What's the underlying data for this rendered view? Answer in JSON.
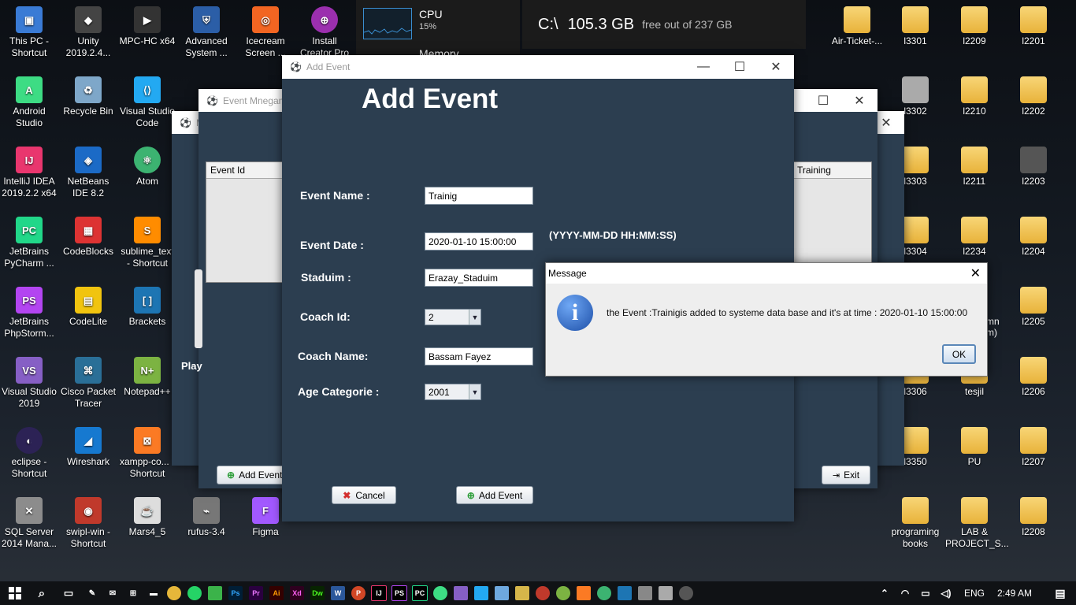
{
  "desktop": {
    "col1": [
      {
        "label": "This PC - Shortcut",
        "color": "#3a7bd5"
      },
      {
        "label": "Android Studio",
        "color": "#3ddc84"
      },
      {
        "label": "IntelliJ IDEA 2019.2.2 x64",
        "color": "#e9366e"
      },
      {
        "label": "JetBrains PyCharm ...",
        "color": "#21d789"
      },
      {
        "label": "JetBrains PhpStorm...",
        "color": "#b345f1"
      },
      {
        "label": "Visual Studio 2019",
        "color": "#865fc5"
      },
      {
        "label": "eclipse - Shortcut",
        "color": "#2c2255"
      },
      {
        "label": "SQL Server 2014 Mana...",
        "color": "#8c8c8c"
      }
    ],
    "col2": [
      {
        "label": "Unity 2019.2.4...",
        "color": "#444"
      },
      {
        "label": "Recycle Bin",
        "color": "#7ea7c9"
      },
      {
        "label": "NetBeans IDE 8.2",
        "color": "#1b6ac6"
      },
      {
        "label": "CodeBlocks",
        "color": "#d33"
      },
      {
        "label": "CodeLite",
        "color": "#f1c40f"
      },
      {
        "label": "Cisco Packet Tracer",
        "color": "#2a6f97"
      },
      {
        "label": "Wireshark",
        "color": "#1679d0"
      },
      {
        "label": "swipl-win - Shortcut",
        "color": "#c0392b"
      }
    ],
    "col3": [
      {
        "label": "MPC-HC x64",
        "color": "#333"
      },
      {
        "label": "Visual Studio Code",
        "color": "#23a9f2"
      },
      {
        "label": "Atom",
        "color": "#3cb371"
      },
      {
        "label": "sublime_text - Shortcut",
        "color": "#ff8c00"
      },
      {
        "label": "Brackets",
        "color": "#1d75b3"
      },
      {
        "label": "Notepad++",
        "color": "#7cb342"
      },
      {
        "label": "xampp-co... - Shortcut",
        "color": "#fb7a24"
      },
      {
        "label": "Mars4_5",
        "color": "#ddd"
      }
    ],
    "col4": [
      {
        "label": "Advanced System ...",
        "color": "#2b5ea7"
      }
    ],
    "col5": [
      {
        "label": "Icecream Screen ...",
        "color": "#f26522"
      }
    ],
    "col6": [
      {
        "label": "Install Creator Pro",
        "color": "#9b2fae"
      }
    ],
    "bottom_extra": [
      {
        "label": "rufus-3.4",
        "color": "#777"
      },
      {
        "label": "Figma",
        "color": "#a259ff"
      }
    ],
    "right_col1": [
      {
        "label": "Air-Ticket-..."
      },
      {
        "label": "l3302"
      },
      {
        "label": "l3303"
      },
      {
        "label": "l3304"
      },
      {
        "label": "l3306"
      },
      {
        "label": "l3350"
      },
      {
        "label": "programing books"
      }
    ],
    "right_col2": [
      {
        "label": "l3301"
      },
      {
        "label": "l2210"
      },
      {
        "label": "l2211"
      },
      {
        "label": "l2234"
      },
      {
        "label": "tesjil"
      },
      {
        "label": "PU"
      },
      {
        "label": "LAB & PROJECT_S..."
      }
    ],
    "right_col3": [
      {
        "label": "l2209"
      },
      {
        "label": "l2202"
      },
      {
        "label": "l2203"
      },
      {
        "label": "l2204"
      },
      {
        "label": "l2205"
      },
      {
        "label": "l2206"
      },
      {
        "label": "l2207"
      },
      {
        "label": "l2208"
      }
    ],
    "right_col4": [
      {
        "label": "l2201"
      }
    ],
    "partial_text": [
      "mn",
      "m)"
    ]
  },
  "cpu_widget": {
    "title": "CPU",
    "value": "15%",
    "next": "Memory"
  },
  "disk_widget": {
    "drive": "C:\\",
    "free": "105.3 GB",
    "suffix": "free out of 237 GB"
  },
  "bg_window_1": {
    "title": "M"
  },
  "bg_window_2": {
    "title": "Event Mnegam",
    "col_left": "Event Id",
    "col_right": "Training",
    "add_button": "Add Event",
    "exit_button": "Exit",
    "partial": "Play"
  },
  "add_event_window": {
    "title": "Add Event",
    "heading": "Add Event",
    "fields": {
      "event_name_label": "Event Name :",
      "event_name_value": "Trainig",
      "event_date_label": "Event Date :",
      "event_date_value": "2020-01-10 15:00:00",
      "date_hint": "(YYYY-MM-DD HH:MM:SS)",
      "stadium_label": "Staduim :",
      "stadium_value": "Erazay_Staduim",
      "coach_id_label": "Coach Id:",
      "coach_id_value": "2",
      "coach_name_label": "Coach Name:",
      "coach_name_value": "Bassam Fayez",
      "age_label": "Age Categorie :",
      "age_value": "2001"
    },
    "cancel_button": "Cancel",
    "add_button": "Add Event"
  },
  "message_dialog": {
    "title": "Message",
    "text": "the Event :Trainigis added to systeme data base and it's at time : 2020-01-10 15:00:00",
    "ok": "OK"
  },
  "taskbar": {
    "apps": [
      "Ps",
      "Pr",
      "Ai",
      "Xd",
      "Dw",
      "W",
      "P",
      "IJ",
      "PS",
      "PC"
    ],
    "lang": "ENG",
    "time": "2:49 AM"
  }
}
